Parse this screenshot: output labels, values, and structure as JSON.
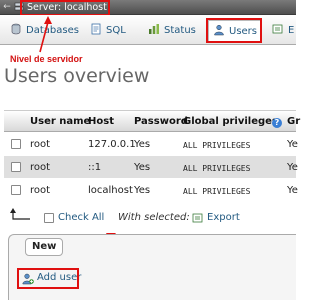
{
  "server_bar": {
    "title": "Server: localhost",
    "back_icon": "arrow-left",
    "server_icon": "server-icon"
  },
  "tabs": [
    {
      "label": "Databases",
      "icon": "database-icon",
      "active": false
    },
    {
      "label": "SQL",
      "icon": "sql-icon",
      "active": false
    },
    {
      "label": "Status",
      "icon": "status-icon",
      "active": false
    },
    {
      "label": "Users",
      "icon": "users-icon",
      "active": true
    },
    {
      "label": "E",
      "icon": "export-icon",
      "active": false
    }
  ],
  "annotations": {
    "server_level": "Nivel de servidor",
    "color": "#e01010"
  },
  "page_title": "Users overview",
  "table": {
    "headers": [
      "User name",
      "Host",
      "Password",
      "Global privileges",
      "Gr"
    ],
    "rows": [
      {
        "user": "root",
        "host": "127.0.0.1",
        "password": "Yes",
        "privileges": "ALL PRIVILEGES",
        "grant": "Ye"
      },
      {
        "user": "root",
        "host": "::1",
        "password": "Yes",
        "privileges": "ALL PRIVILEGES",
        "grant": "Ye"
      },
      {
        "user": "root",
        "host": "localhost",
        "password": "Yes",
        "privileges": "ALL PRIVILEGES",
        "grant": "Ye"
      }
    ]
  },
  "footer": {
    "check_all": "Check All",
    "with_selected": "With selected:",
    "export": "Export"
  },
  "new_section": {
    "legend": "New",
    "add_user": "Add user"
  },
  "colors": {
    "link": "#235a81",
    "annotation_red": "#e01010",
    "row_alt": "#dfdfdf"
  }
}
